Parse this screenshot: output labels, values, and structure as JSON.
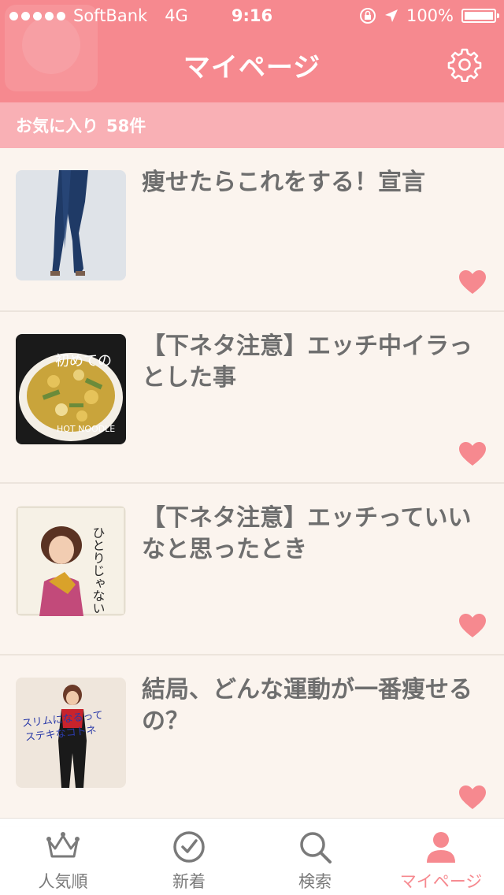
{
  "status": {
    "carrier": "SoftBank",
    "network": "4G",
    "time": "9:16",
    "battery": "100%"
  },
  "header": {
    "title": "マイページ",
    "settings_icon": "gear-icon"
  },
  "favorites": {
    "label": "お気に入り",
    "count": "58件"
  },
  "items": [
    {
      "title": "痩せたらこれをする！宣言",
      "thumb": "jeans-legs-photo"
    },
    {
      "title": "【下ネタ注意】エッチ中イラっとした事",
      "thumb": "noodle-cup-photo"
    },
    {
      "title": "【下ネタ注意】エッチっていいなと思ったとき",
      "thumb": "record-cover-photo"
    },
    {
      "title": "結局、どんな運動が一番痩せるの？",
      "thumb": "record-cover-2-photo"
    }
  ],
  "tabs": [
    {
      "label": "人気順",
      "icon": "crown-icon"
    },
    {
      "label": "新着",
      "icon": "clock-icon"
    },
    {
      "label": "検索",
      "icon": "search-icon"
    },
    {
      "label": "マイページ",
      "icon": "person-icon"
    }
  ],
  "colors": {
    "accent": "#f6898f",
    "subbar": "#f9b0b5",
    "background": "#fbf4ee",
    "title_text": "#6e6e6e"
  }
}
